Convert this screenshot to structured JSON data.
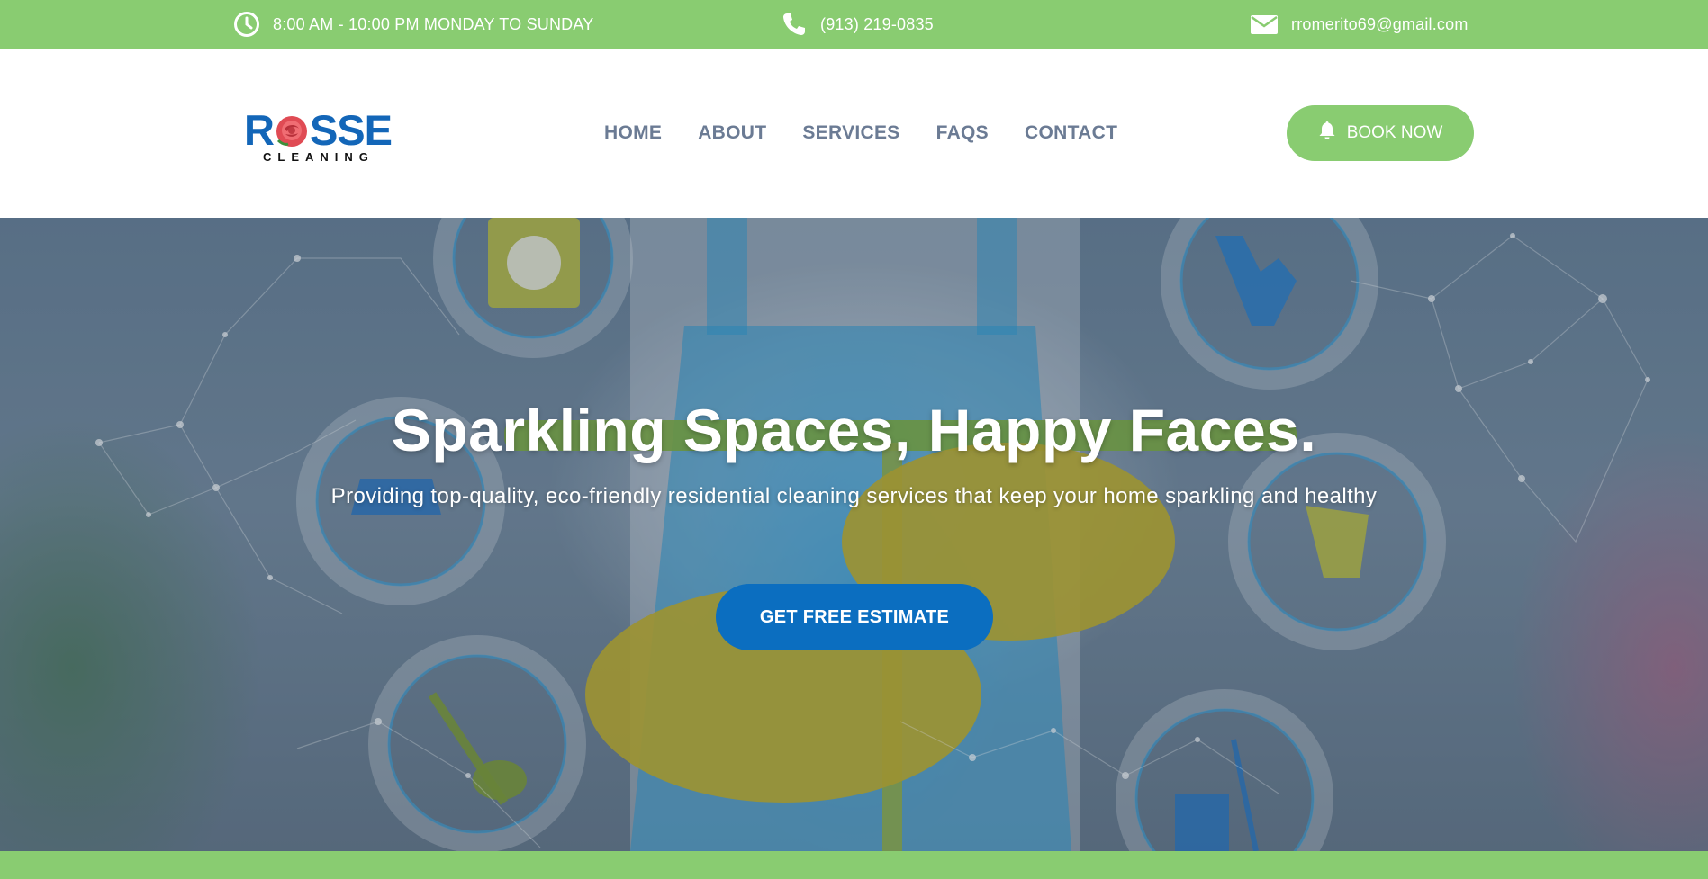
{
  "topbar": {
    "hours": "8:00 AM - 10:00 PM MONDAY TO SUNDAY",
    "phone": "(913) 219-0835",
    "email": "rromerito69@gmail.com",
    "icons": [
      "clock-icon",
      "phone-icon",
      "envelope-icon"
    ]
  },
  "logo": {
    "word": "ROSSE",
    "word_pre": "R",
    "word_post": "SSE",
    "sub": "CLEANING"
  },
  "nav": {
    "items": [
      "HOME",
      "ABOUT",
      "SERVICES",
      "FAQS",
      "CONTACT"
    ]
  },
  "header": {
    "book_label": "BOOK NOW",
    "book_icon": "bell-icon"
  },
  "hero": {
    "title": "Sparkling Spaces, Happy Faces.",
    "subtitle": "Providing top-quality, eco-friendly residential cleaning services that keep your home sparkling and healthy",
    "cta_label": "GET FREE ESTIMATE"
  },
  "colors": {
    "brand_green": "#89cc71",
    "brand_blue": "#0b6ec0",
    "nav_text": "#6b7b94",
    "logo_blue": "#1366b8",
    "rose_red": "#e04b54"
  }
}
